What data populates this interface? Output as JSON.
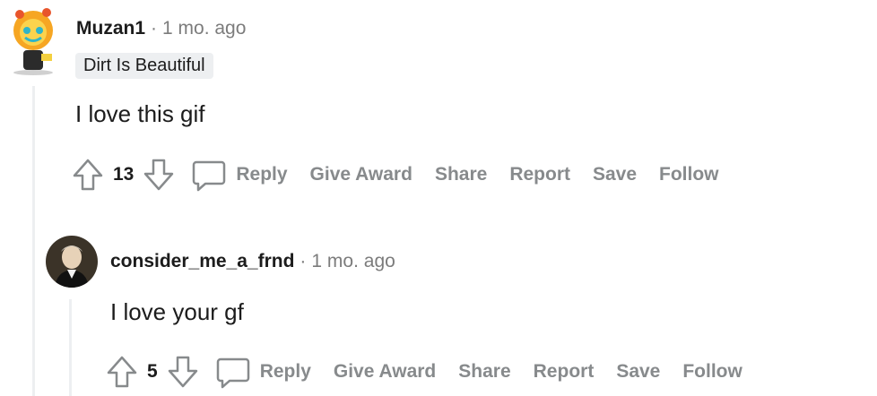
{
  "comments": [
    {
      "username": "Muzan1",
      "separator": "·",
      "time": "1 mo. ago",
      "flair": "Dirt Is Beautiful",
      "body": "I love this gif",
      "score": "13",
      "actions": {
        "reply": "Reply",
        "give_award": "Give Award",
        "share": "Share",
        "report": "Report",
        "save": "Save",
        "follow": "Follow"
      }
    },
    {
      "username": "consider_me_a_frnd",
      "separator": "·",
      "time": "1 mo. ago",
      "body": "I love your gf",
      "score": "5",
      "actions": {
        "reply": "Reply",
        "give_award": "Give Award",
        "share": "Share",
        "report": "Report",
        "save": "Save",
        "follow": "Follow"
      }
    }
  ],
  "icons": {
    "upvote": "arrow-up-icon",
    "downvote": "arrow-down-icon",
    "reply": "speech-bubble-icon"
  },
  "colors": {
    "action_gray": "#878a8c",
    "meta_gray": "#7c7c7c",
    "flair_bg": "#edeff1",
    "thread_line": "#edeff1"
  }
}
